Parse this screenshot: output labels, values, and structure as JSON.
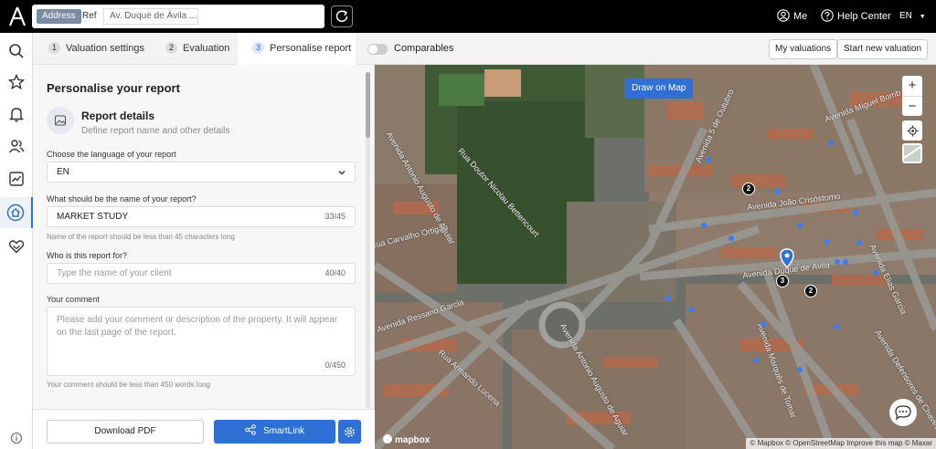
{
  "topbar": {
    "address_toggle": "Address",
    "ref_toggle": "Ref",
    "address_value": "Av. Duque de Ávila ...",
    "me_label": "Me",
    "help_label": "Help Center",
    "lang_label": "EN"
  },
  "tabs": [
    {
      "num": "1",
      "label": "Valuation settings"
    },
    {
      "num": "2",
      "label": "Evaluation"
    },
    {
      "num": "3",
      "label": "Personalise report"
    }
  ],
  "toolbar": {
    "comparables_label": "Comparables",
    "my_valuations": "My valuations",
    "start_new": "Start new valuation"
  },
  "form": {
    "title": "Personalise your report",
    "section_title": "Report details",
    "section_sub": "Define report name and other details",
    "lang_label": "Choose the language of your report",
    "lang_value": "EN",
    "name_label": "What should be the name of your report?",
    "name_value": "MARKET STUDY",
    "name_count": "33/45",
    "name_hint": "Name of the report should be less than 45 characters long",
    "client_label": "Who is this report for?",
    "client_placeholder": "Type the name of your client",
    "client_count": "40/40",
    "comment_label": "Your comment",
    "comment_placeholder": "Please add your comment or description of the property. It will appear on the last page of the report.",
    "comment_count": "0/450",
    "comment_hint": "Your comment should be less than 450 words long"
  },
  "footer": {
    "download_pdf": "Download PDF",
    "smartlink": "SmartLink"
  },
  "map": {
    "draw_label": "Draw on Map",
    "zoom_in": "+",
    "zoom_out": "−",
    "logo": "mapbox",
    "attribution": "© Mapbox © OpenStreetMap Improve this map © Maxar",
    "streets": [
      "Avenida Miguel Bomb",
      "Avenida Duque de Ávila",
      "Avenida João Crisóstomo",
      "Avenida Antonio Augusto de Aguiar",
      "Rua Doutor Nicolau Bettencourt",
      "Avenida 5 de Outubro",
      "Avenida Elias Garcia",
      "Avenida Ressano Garcia",
      "Rua Carvalho Ortigão",
      "Avenida Antonio Augusto de Aguiar",
      "Rua Armando Lucena",
      "Avenida Marquês de Tomar",
      "Avenida Defensores de Chaves"
    ],
    "clusters": [
      {
        "label": "2"
      },
      {
        "label": "3"
      },
      {
        "label": "2"
      }
    ]
  },
  "colors": {
    "accent": "#2f6fd6",
    "topbar": "#000000",
    "marker_dot": "#3c7cf0"
  }
}
